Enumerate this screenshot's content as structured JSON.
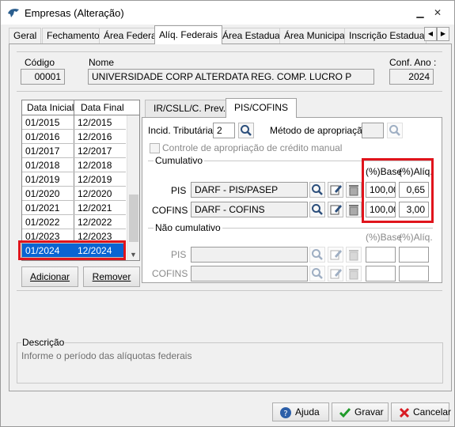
{
  "window": {
    "title": "Empresas (Alteração)",
    "minimize_glyph": "▁",
    "close_glyph": "✕"
  },
  "tabs": [
    {
      "label": "Geral"
    },
    {
      "label": "Fechamento"
    },
    {
      "label": "Área Federal"
    },
    {
      "label": "Alíq. Federais"
    },
    {
      "label": "Área Estadual"
    },
    {
      "label": "Área Municipal"
    },
    {
      "label": "Inscrição Estadual S"
    }
  ],
  "tab_scroll": {
    "left": "◀",
    "right": "▶"
  },
  "header": {
    "codigo_label": "Código",
    "codigo_value": "00001",
    "nome_label": "Nome",
    "nome_value": "UNIVERSIDADE CORP ALTERDATA REG. COMP. LUCRO P",
    "conf_ano_label": "Conf. Ano :",
    "conf_ano_value": "2024"
  },
  "periods": {
    "columns": [
      "Data Inicial",
      "Data Final"
    ],
    "rows": [
      [
        "01/2015",
        "12/2015"
      ],
      [
        "01/2016",
        "12/2016"
      ],
      [
        "01/2017",
        "12/2017"
      ],
      [
        "01/2018",
        "12/2018"
      ],
      [
        "01/2019",
        "12/2019"
      ],
      [
        "01/2020",
        "12/2020"
      ],
      [
        "01/2021",
        "12/2021"
      ],
      [
        "01/2022",
        "12/2022"
      ],
      [
        "01/2023",
        "12/2023"
      ],
      [
        "01/2024",
        "12/2024"
      ]
    ],
    "selected_row": "01/2024",
    "add_button": "Adicionar",
    "remove_button": "Remover"
  },
  "inner_tabs": [
    {
      "label": "IR/CSLL/C. Prev."
    },
    {
      "label": "PIS/COFINS"
    }
  ],
  "pis_cofins": {
    "incid_label": "Incid. Tributária:",
    "incid_value": "2",
    "metodo_label": "Método de apropriação:",
    "metodo_value": "",
    "controle_label": "Controle de apropriação de crédito manual",
    "cumulativo": {
      "title": "Cumulativo",
      "base_header": "(%)Base",
      "aliq_header": "(%)Alíq.",
      "rows": [
        {
          "label": "PIS",
          "darf": "DARF - PIS/PASEP",
          "base": "100,00",
          "aliq": "0,65"
        },
        {
          "label": "COFINS",
          "darf": "DARF - COFINS",
          "base": "100,00",
          "aliq": "3,00"
        }
      ]
    },
    "nao_cumulativo": {
      "title": "Não cumulativo",
      "base_header": "(%)Base",
      "aliq_header": "(%)Alíq.",
      "rows": [
        {
          "label": "PIS",
          "darf": "",
          "base": "",
          "aliq": ""
        },
        {
          "label": "COFINS",
          "darf": "",
          "base": "",
          "aliq": ""
        }
      ]
    }
  },
  "descricao": {
    "title": "Descrição",
    "text": "Informe o período das alíquotas federais"
  },
  "buttons": {
    "help": "Ajuda",
    "save": "Gravar",
    "cancel": "Cancelar"
  },
  "colors": {
    "highlight": "#e0141c",
    "selection": "#0a64d2"
  }
}
